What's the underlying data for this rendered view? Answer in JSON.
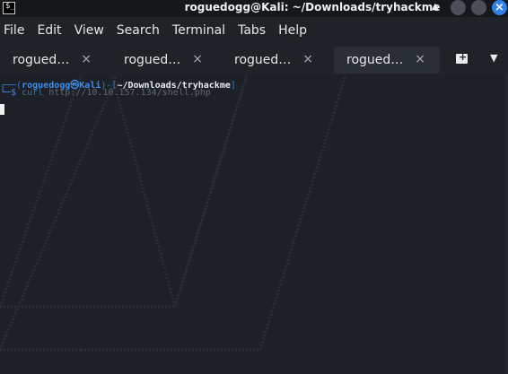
{
  "window": {
    "title": "roguedogg@Kali: ~/Downloads/tryhackme",
    "app_icon_glyph": "$_",
    "caret_glyph": "▲",
    "close_glyph": "×"
  },
  "menu": {
    "items": [
      "File",
      "Edit",
      "View",
      "Search",
      "Terminal",
      "Tabs",
      "Help"
    ]
  },
  "tabs": [
    {
      "label": "rogued…",
      "close": "×",
      "active": false
    },
    {
      "label": "rogued…",
      "close": "×",
      "active": false
    },
    {
      "label": "rogued…",
      "close": "×",
      "active": false
    },
    {
      "label": "rogued…",
      "close": "×",
      "active": true
    }
  ],
  "tab_toolbar": {
    "new_tab_icon": "new-tab-icon",
    "menu_glyph": "▼"
  },
  "terminal": {
    "prompt_open": "┌──(",
    "user_host": "roguedogg㉿Kali",
    "prompt_mid": ")-[",
    "cwd": "~/Downloads/tryhackme",
    "prompt_close": "]",
    "prompt_line2": "└─$ ",
    "command": "curl",
    "argument": " http://10.10.157.134/shell.php"
  },
  "colors": {
    "background": "#1d2026",
    "accent_blue": "#3c8df0",
    "close_button": "#2f81e8"
  }
}
